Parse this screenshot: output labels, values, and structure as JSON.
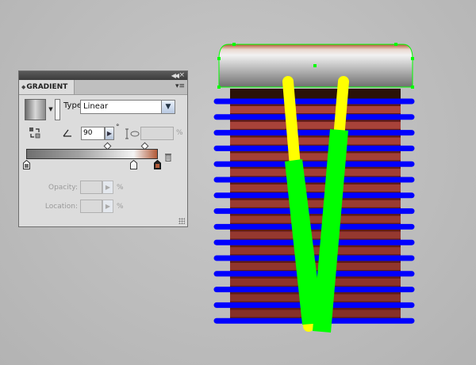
{
  "panel": {
    "title": "GRADIENT",
    "type_label": "Type:",
    "type_value": "Linear",
    "angle_value": "90",
    "degree_sign": "°",
    "aspect_value": "",
    "aspect_unit": "%",
    "opacity_label": "Opacity:",
    "opacity_unit": "%",
    "location_label": "Location:",
    "location_unit": "%",
    "gradient_stops": [
      "#707070",
      "#f4f4f4",
      "#b25a38"
    ],
    "colors": {
      "panel_bg": "#dcdcdc",
      "select_button": "#b8c9e2"
    }
  },
  "artwork": {
    "colors": {
      "cap_gradient": [
        "#b3552f",
        "#f2f2f2",
        "#6f6f6f"
      ],
      "body_light": "#b0463c",
      "body_dark": "#5f1c16",
      "stripes": "#0000ff",
      "arm_yellow": "#ffff00",
      "arm_green": "#00ff00",
      "selection": "#00ff00"
    }
  }
}
